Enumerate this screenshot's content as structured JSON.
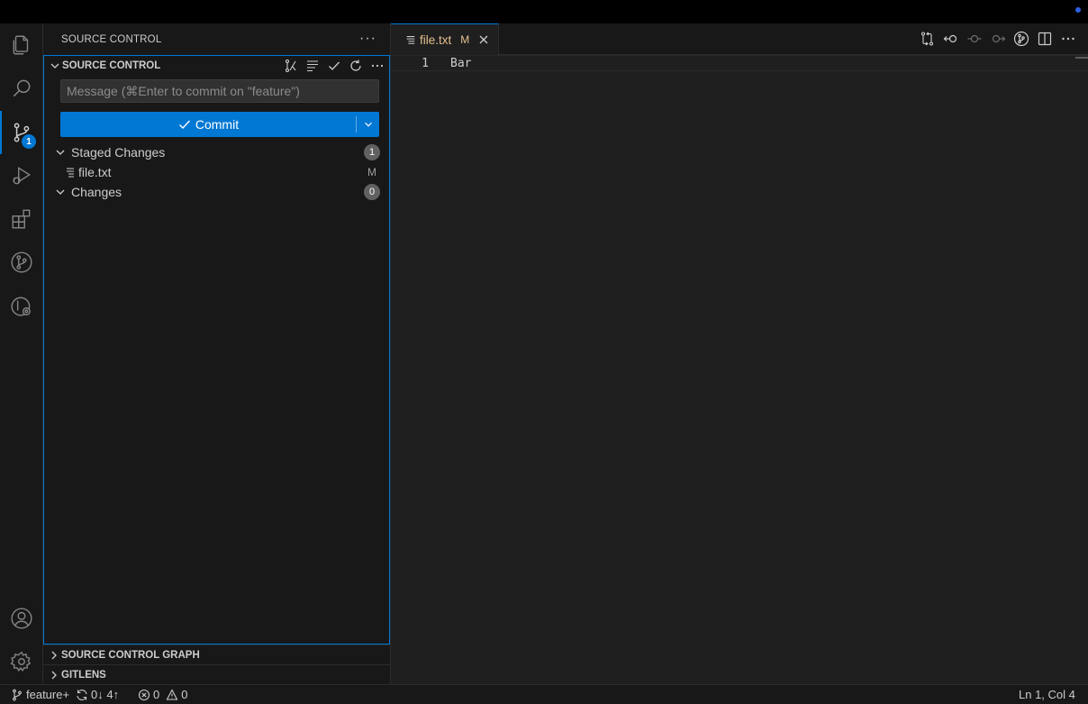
{
  "colors": {
    "accent": "#0078d4",
    "modified": "#e2c08d",
    "background": "#181818",
    "editor_bg": "#1f1f1f"
  },
  "activity_bar": {
    "items": [
      {
        "icon": "files-icon",
        "label": "Explorer"
      },
      {
        "icon": "search-icon",
        "label": "Search"
      },
      {
        "icon": "source-control-icon",
        "label": "Source Control",
        "badge": "1"
      },
      {
        "icon": "run-debug-icon",
        "label": "Run and Debug"
      },
      {
        "icon": "extensions-icon",
        "label": "Extensions"
      },
      {
        "icon": "gitlens-icon",
        "label": "GitLens"
      },
      {
        "icon": "gitlens-inspect-icon",
        "label": "GitLens Inspect"
      }
    ],
    "bottom": [
      {
        "icon": "accounts-icon",
        "label": "Accounts"
      },
      {
        "icon": "manage-gear-icon",
        "label": "Manage"
      }
    ]
  },
  "sidebar": {
    "title": "SOURCE CONTROL",
    "section_title": "SOURCE CONTROL",
    "commit_message_placeholder": "Message (⌘Enter to commit on \"feature\")",
    "commit_button_label": "Commit",
    "staged": {
      "label": "Staged Changes",
      "count": "1",
      "files": [
        {
          "name": "file.txt",
          "status": "M"
        }
      ]
    },
    "changes": {
      "label": "Changes",
      "count": "0"
    },
    "collapsed_sections": [
      "SOURCE CONTROL GRAPH",
      "GITLENS"
    ]
  },
  "editor": {
    "tab": {
      "name": "file.txt",
      "status": "M"
    },
    "lines": [
      {
        "number": "1",
        "text": "Bar"
      }
    ]
  },
  "status_bar": {
    "branch": "feature+",
    "sync": "0↓ 4↑",
    "errors": "0",
    "warnings": "0",
    "cursor": "Ln 1, Col 4"
  }
}
